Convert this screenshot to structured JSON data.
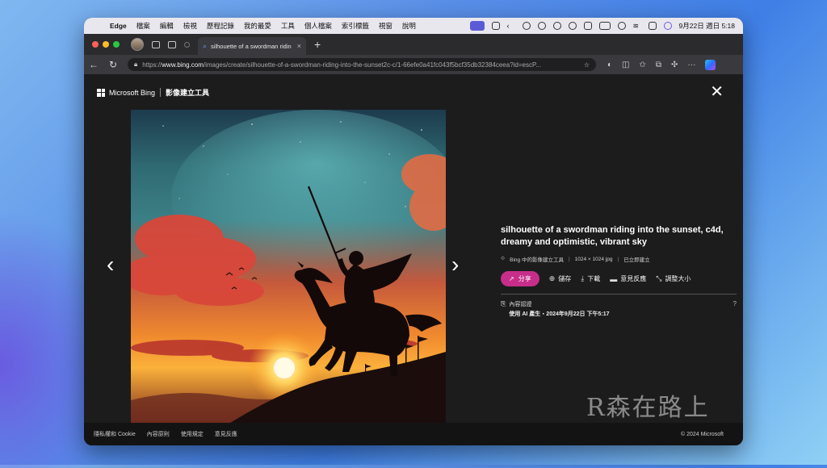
{
  "menubar": {
    "apple": "",
    "items": [
      "Edge",
      "檔案",
      "編輯",
      "檢視",
      "歷程記錄",
      "我的最愛",
      "工具",
      "個人檔案",
      "索引標籤",
      "視窗",
      "說明"
    ],
    "clock": "9月22日 週日 5:18"
  },
  "tab": {
    "title": "silhouette of a swordman ridin",
    "close": "×",
    "new": "+"
  },
  "address": {
    "scheme": "https://",
    "host": "www.bing.com",
    "path": "/images/create/silhouette-of-a-swordman-riding-into-the-sunset2c-c/1-66efe0a41fc043f5bcf35db32384ceea?id=escP..."
  },
  "header": {
    "brand": "Microsoft Bing",
    "tool": "影像建立工具",
    "close": "✕"
  },
  "arrows": {
    "prev": "‹",
    "next": "›"
  },
  "image": {
    "title": "silhouette of a swordman riding into the sunset, c4d, dreamy and optimistic, vibrant sky",
    "source": "Bing 中的影像建立工具",
    "size": "1024 × 1024 jpg",
    "status": "已立即建立"
  },
  "actions": {
    "share": "分享",
    "save": "儲存",
    "download": "下載",
    "feedback": "意見反應",
    "resize": "調整大小"
  },
  "credentials": {
    "label": "內容認證",
    "detail": "使用 AI 產生・2024年9月22日 下午5:17",
    "help": "?"
  },
  "watermark": "R森在路上",
  "footer": {
    "links": [
      "隱私權和 Cookie",
      "內容原則",
      "使用規定",
      "意見反應"
    ],
    "copyright": "© 2024 Microsoft"
  }
}
